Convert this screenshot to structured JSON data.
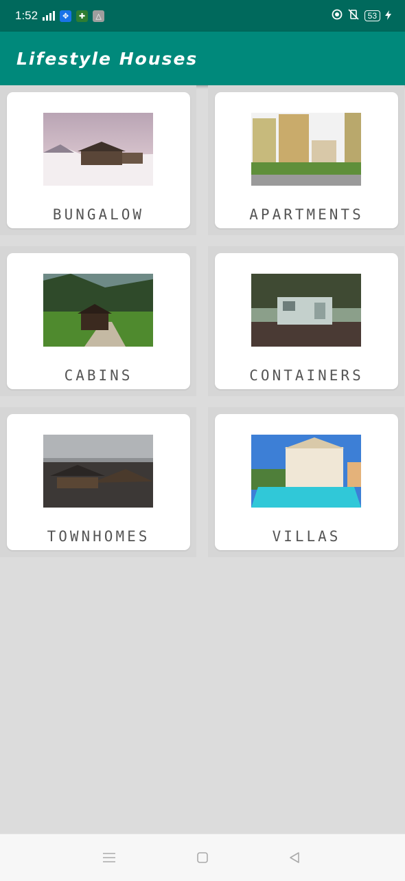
{
  "status_bar": {
    "time": "1:52",
    "battery": "53",
    "icons": [
      "signal-icon",
      "vpn-icon",
      "puzzle-icon",
      "drive-icon",
      "data-saver-icon",
      "vibrate-off-icon",
      "battery-icon",
      "charging-icon"
    ]
  },
  "app_bar": {
    "title": "Lifestyle Houses"
  },
  "categories": [
    {
      "label": "BUNGALOW",
      "image": "snowy-cabin-image"
    },
    {
      "label": "APARTMENTS",
      "image": "apartment-towers-image"
    },
    {
      "label": "CABINS",
      "image": "mountain-cabin-image"
    },
    {
      "label": "CONTAINERS",
      "image": "container-home-image"
    },
    {
      "label": "TOWNHOMES",
      "image": "temple-rooftops-image"
    },
    {
      "label": "VILLAS",
      "image": "villa-pool-image"
    }
  ],
  "nav_bar": {
    "icons": [
      "menu-icon",
      "home-icon",
      "back-icon"
    ]
  },
  "colors": {
    "primary": "#00897b",
    "primary_dark": "#00695c",
    "background": "#dcdcdc",
    "card": "#ffffff",
    "label": "#555555"
  }
}
